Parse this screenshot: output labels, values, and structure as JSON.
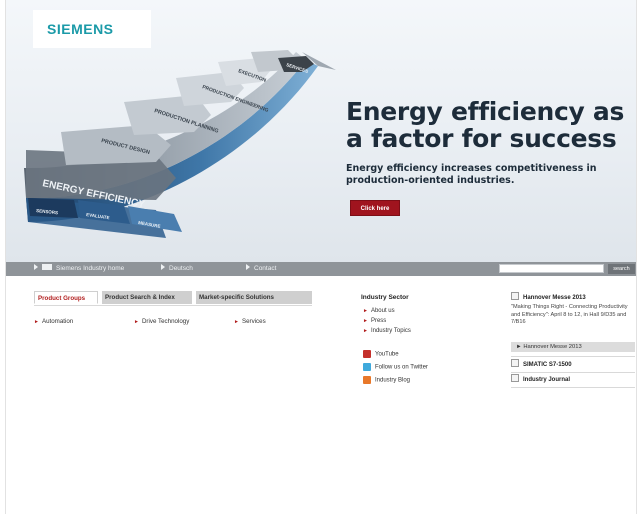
{
  "header": {
    "logo": "SIEMENS"
  },
  "hero": {
    "headline_line1": "Energy efficiency as",
    "headline_line2": "a factor for success",
    "subline": "Energy efficiency increases competitiveness in production-oriented industries.",
    "cta_label": "Click here",
    "arrow_labels": [
      "ENERGY EFFICIENCY",
      "PRODUCT DESIGN",
      "PRODUCTION PLANNING",
      "PRODUCTION ENGINEERING",
      "EXECUTION",
      "SERVICES"
    ],
    "bottom_labels": [
      "SENSORS",
      "EVALUATE",
      "MEASURE"
    ]
  },
  "nav": {
    "items": [
      "Siemens Industry home",
      "Deutsch",
      "Contact"
    ],
    "search_label": "search",
    "search_placeholder": ""
  },
  "tabs": [
    "Product Groups",
    "Product Search & Index",
    "Market-specific Solutions"
  ],
  "product_groups": [
    "Automation",
    "Drive Technology",
    "Services"
  ],
  "industry_sector": {
    "title": "Industry Sector",
    "links": [
      "About us",
      "Press",
      "Industry Topics"
    ],
    "social": [
      "YouTube",
      "Follow us on Twitter",
      "Industry Blog"
    ]
  },
  "right_col": {
    "hannover_title": "Hannover Messe 2013",
    "hannover_text": "\"Making Things Right - Connecting Productivity and Efficiency\": April 8 to 12, in Hall 9/D35 and 7/B16",
    "hannover_link": "Hannover Messe 2013",
    "items": [
      "SIMATIC S7-1500",
      "Industry Journal"
    ]
  },
  "colors": {
    "brand": "#1b9aa8",
    "accent_red": "#a0141e",
    "nav_bg": "#8f9499",
    "link_red": "#b11d1d"
  }
}
